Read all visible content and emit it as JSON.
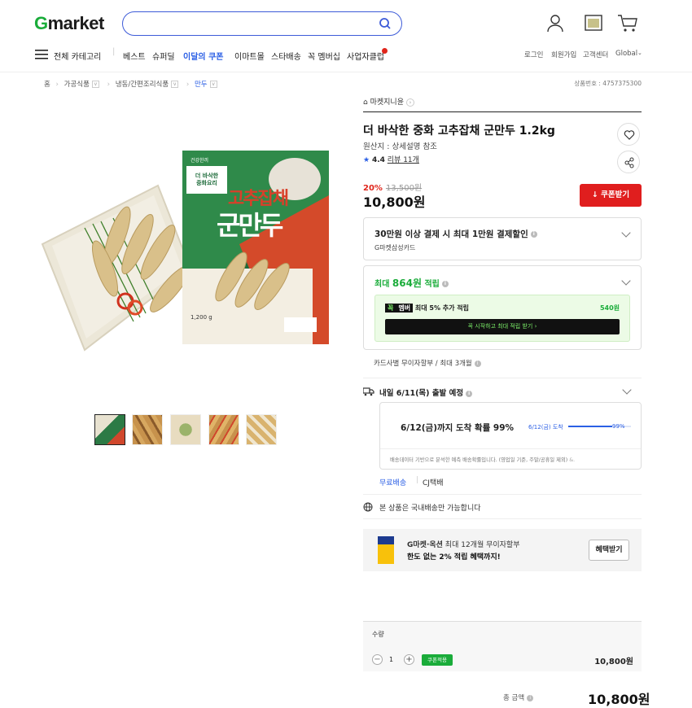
{
  "header": {
    "logo_g": "G",
    "logo_rest": "market",
    "search_placeholder": ""
  },
  "nav": {
    "all_category": "전체 카테고리",
    "items": [
      "베스트",
      "슈퍼딜",
      "이달의 쿠폰",
      "이마트몰",
      "스타배송",
      "꼭 멤버십",
      "사업자클럽"
    ],
    "right": [
      "로그인",
      "회원가입",
      "고객센터",
      "Global"
    ]
  },
  "breadcrumb": [
    "홈",
    "가공식품",
    "냉동/간편조리식품",
    "만두"
  ],
  "product_no": "상품번호 : 4757375300",
  "product": {
    "store": "마켓지니윤",
    "title": "더 바삭한 중화 고추잡채 군만두 1.2kg",
    "origin": "원산지 : 상세설명 참조",
    "rating": "4.4",
    "reviews": "리뷰 11개",
    "discount": "20%",
    "original_price": "13,500원",
    "price": "10,800원",
    "coupon_button": "쿠폰받기",
    "package_brand": "건강한끼",
    "package_line1": "더 바삭한",
    "package_line2": "중화요리",
    "package_main1": "고추잡채",
    "package_main2": "군만두",
    "package_weight": "1,200 g"
  },
  "benefits": {
    "card_title": "30만원 이상 결제 시 최대 1만원 결제할인",
    "card_sub": "G마켓삼성카드",
    "points_label": "최대",
    "points_value": "864원",
    "points_suffix": "적립",
    "member_badge_1": "꼭",
    "member_badge_2": "멤버",
    "member_text": "최대 5% 추가 적립",
    "member_amount": "540원",
    "member_cta": "꼭 시작하고 최대 적립 받기  ›",
    "installment": "카드사별 무이자할부 / 최대 3개월"
  },
  "delivery": {
    "title": "내일 6/11(목) 출발 예정",
    "prob_title": "6/12(금)까지 도착 확률 99%",
    "prob_label": "6/12(금) 도착",
    "prob_pct": "99%",
    "prob_value": 0.99,
    "note": "배송데이터 기반으로 분석한 예측 배송확률입니다. (영업일 기준, 주말/공휴일 제외)",
    "free": "무료배송",
    "carrier": "CJ택배",
    "domestic": "본 상품은 국내배송만 가능합니다"
  },
  "promo": {
    "line1_bold": "G마켓·옥션",
    "line1_rest": " 최대 12개월 무이자할부",
    "line2": "한도 없는 2% 적립 혜택까지!",
    "button": "혜택받기"
  },
  "order": {
    "qty_label": "수량",
    "qty": "1",
    "coupon_tag": "쿠폰적용",
    "line_price": "10,800원",
    "total_label": "총 금액",
    "total": "10,800원"
  },
  "colors": {
    "brand_green": "#1aac3a",
    "accent_blue": "#2b5fe5",
    "coupon_red": "#e01e1e"
  }
}
